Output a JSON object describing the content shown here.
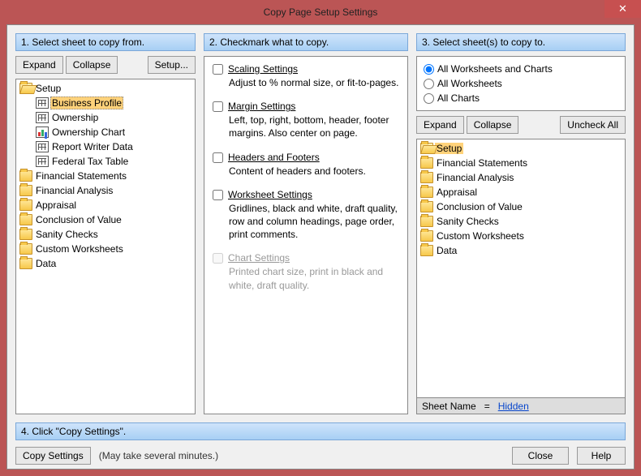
{
  "title": "Copy Page Setup Settings",
  "close_glyph": "✕",
  "step1": {
    "header": "1.  Select sheet to copy from.",
    "expand": "Expand",
    "collapse": "Collapse",
    "setup": "Setup...",
    "tree": [
      {
        "type": "folder-open",
        "label": "Setup",
        "children": [
          {
            "type": "sheet",
            "label": "Business Profile",
            "selected": true
          },
          {
            "type": "sheet",
            "label": "Ownership"
          },
          {
            "type": "chart",
            "label": "Ownership Chart"
          },
          {
            "type": "sheet",
            "label": "Report Writer Data"
          },
          {
            "type": "sheet",
            "label": "Federal Tax Table"
          }
        ]
      },
      {
        "type": "folder-closed",
        "label": "Financial Statements"
      },
      {
        "type": "folder-closed",
        "label": "Financial Analysis"
      },
      {
        "type": "folder-closed",
        "label": "Appraisal"
      },
      {
        "type": "folder-closed",
        "label": "Conclusion of Value"
      },
      {
        "type": "folder-closed",
        "label": "Sanity Checks"
      },
      {
        "type": "folder-closed",
        "label": "Custom Worksheets"
      },
      {
        "type": "folder-closed",
        "label": "Data"
      }
    ]
  },
  "step2": {
    "header": "2.  Checkmark what to copy.",
    "items": [
      {
        "title": "Scaling Settings",
        "desc": "Adjust to % normal size, or fit-to-pages.",
        "disabled": false
      },
      {
        "title": "Margin Settings",
        "desc": "Left, top, right, bottom, header, footer margins.  Also center on page.",
        "disabled": false
      },
      {
        "title": "Headers and Footers",
        "desc": "Content of headers and footers.",
        "disabled": false
      },
      {
        "title": "Worksheet Settings",
        "desc": "Gridlines, black and white, draft quality, row and column headings, page order, print comments.",
        "disabled": false
      },
      {
        "title": "Chart Settings",
        "desc": "Printed chart size, print in black and white, draft quality.",
        "disabled": true
      }
    ]
  },
  "step3": {
    "header": "3.  Select sheet(s) to copy to.",
    "radios": [
      {
        "label": "All Worksheets and Charts",
        "checked": true
      },
      {
        "label": "All Worksheets",
        "checked": false
      },
      {
        "label": "All Charts",
        "checked": false
      }
    ],
    "expand": "Expand",
    "collapse": "Collapse",
    "uncheck": "Uncheck All",
    "tree": [
      {
        "type": "folder-open",
        "label": "Setup",
        "hl": true
      },
      {
        "type": "folder-closed",
        "label": "Financial Statements"
      },
      {
        "type": "folder-closed",
        "label": "Financial Analysis"
      },
      {
        "type": "folder-closed",
        "label": "Appraisal"
      },
      {
        "type": "folder-closed",
        "label": "Conclusion of Value"
      },
      {
        "type": "folder-closed",
        "label": "Sanity Checks"
      },
      {
        "type": "folder-closed",
        "label": "Custom Worksheets"
      },
      {
        "type": "folder-closed",
        "label": "Data"
      }
    ],
    "sheetname_label": "Sheet Name",
    "eq": "=",
    "hidden": "Hidden"
  },
  "step4": {
    "header": "4.  Click \"Copy Settings\".",
    "copy": "Copy Settings",
    "note": "(May take several minutes.)",
    "close_btn": "Close",
    "help": "Help"
  }
}
